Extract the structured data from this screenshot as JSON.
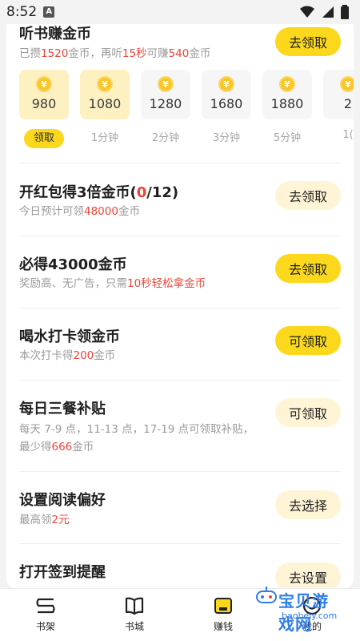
{
  "status": {
    "time": "8:52"
  },
  "listen": {
    "title": "听书赚金币",
    "sub_1": "已攒",
    "sub_coins": "1520",
    "sub_2": "金币，再听",
    "sub_secs": "15秒",
    "sub_3": "可赚",
    "sub_earn": "540",
    "sub_4": "金币",
    "button": "去领取"
  },
  "coin_tiles": [
    {
      "amount": "980",
      "caption": "领取",
      "active": true
    },
    {
      "amount": "1080",
      "caption": "1分钟",
      "active": true
    },
    {
      "amount": "1280",
      "caption": "2分钟",
      "active": false
    },
    {
      "amount": "1680",
      "caption": "3分钟",
      "active": false
    },
    {
      "amount": "1880",
      "caption": "5分钟",
      "active": false
    },
    {
      "amount": "2",
      "caption": "1(",
      "active": false
    }
  ],
  "tasks": [
    {
      "title_a": "开红包得3倍金币(",
      "title_hl": "0",
      "title_b": "/12)",
      "sub_a": "今日预计可领",
      "sub_hl": "48000",
      "sub_b": "金币",
      "button": "去领取",
      "style": "secondary"
    },
    {
      "title_a": "必得43000金币",
      "sub_a": "奖励高、无广告，只需",
      "sub_hl": "10秒轻松拿金币",
      "sub_b": "",
      "button": "去领取",
      "style": "primary"
    },
    {
      "title_a": "喝水打卡领金币",
      "sub_a": "本次打卡得",
      "sub_hl": "200",
      "sub_b": "金币",
      "button": "可领取",
      "style": "primary"
    },
    {
      "title_a": "每日三餐补贴",
      "sub_a": "每天 7-9 点，11-13 点，17-19 点可领取补贴，",
      "sub_line2_a": "最少得",
      "sub_hl": "666",
      "sub_b": "金币",
      "button": "可领取",
      "style": "secondary"
    },
    {
      "title_a": "设置阅读偏好",
      "sub_a": "最高领",
      "sub_hl": "2元",
      "sub_b": "",
      "button": "去选择",
      "style": "secondary"
    },
    {
      "title_a": "打开签到提醒",
      "button": "去设置",
      "style": "secondary"
    }
  ],
  "tabbar": [
    {
      "label": "书架",
      "icon": "bookshelf-icon"
    },
    {
      "label": "书城",
      "icon": "book-icon"
    },
    {
      "label": "赚钱",
      "icon": "wallet-icon"
    },
    {
      "label": "我的",
      "icon": "profile-icon"
    }
  ],
  "watermark": {
    "text": "宝贝游戏网",
    "url": "baobeiy.com"
  },
  "colors": {
    "accent": "#fbd81c",
    "highlight": "#f04438",
    "button_light": "#fff5d6"
  }
}
